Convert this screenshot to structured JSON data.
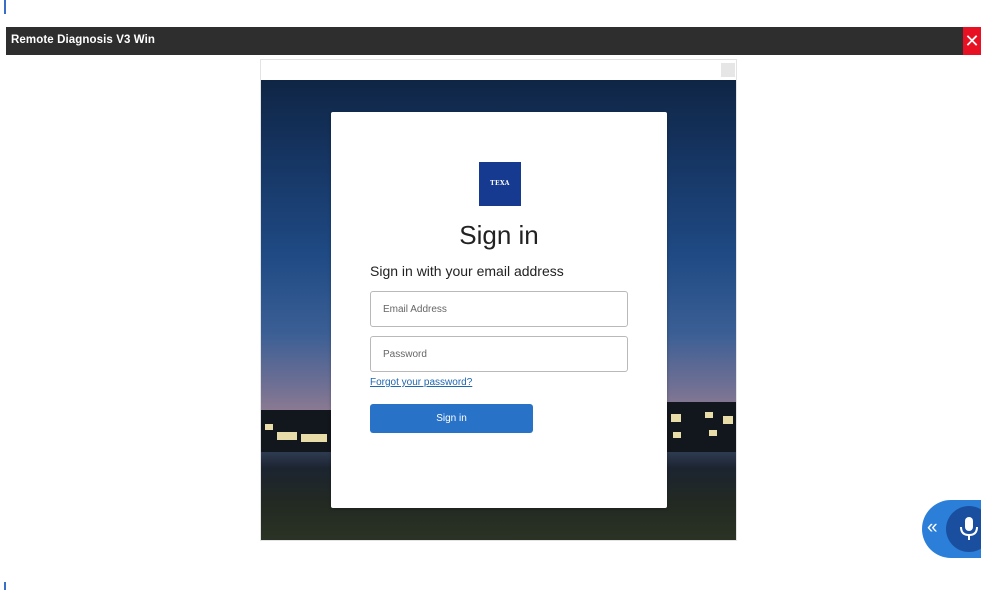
{
  "window": {
    "title": "Remote Diagnosis V3 Win",
    "close_glyph": "✕"
  },
  "card": {
    "logo_text": "TEXA",
    "heading": "Sign in",
    "subheading": "Sign in with your email address",
    "email_placeholder": "Email Address",
    "email_value": "",
    "password_placeholder": "Password",
    "password_value": "",
    "forgot_link": "Forgot your password?",
    "signin_button": "Sign in"
  },
  "voice_widget": {
    "chevron_glyph": "«",
    "icons": [
      "double-chevron-left-icon",
      "microphone-icon"
    ]
  },
  "colors": {
    "titlebar": "#2e2e2e",
    "close": "#e81123",
    "logo": "#163a8f",
    "button": "#2872c8",
    "link": "#2067b0",
    "voice": "#2c7fd9"
  }
}
